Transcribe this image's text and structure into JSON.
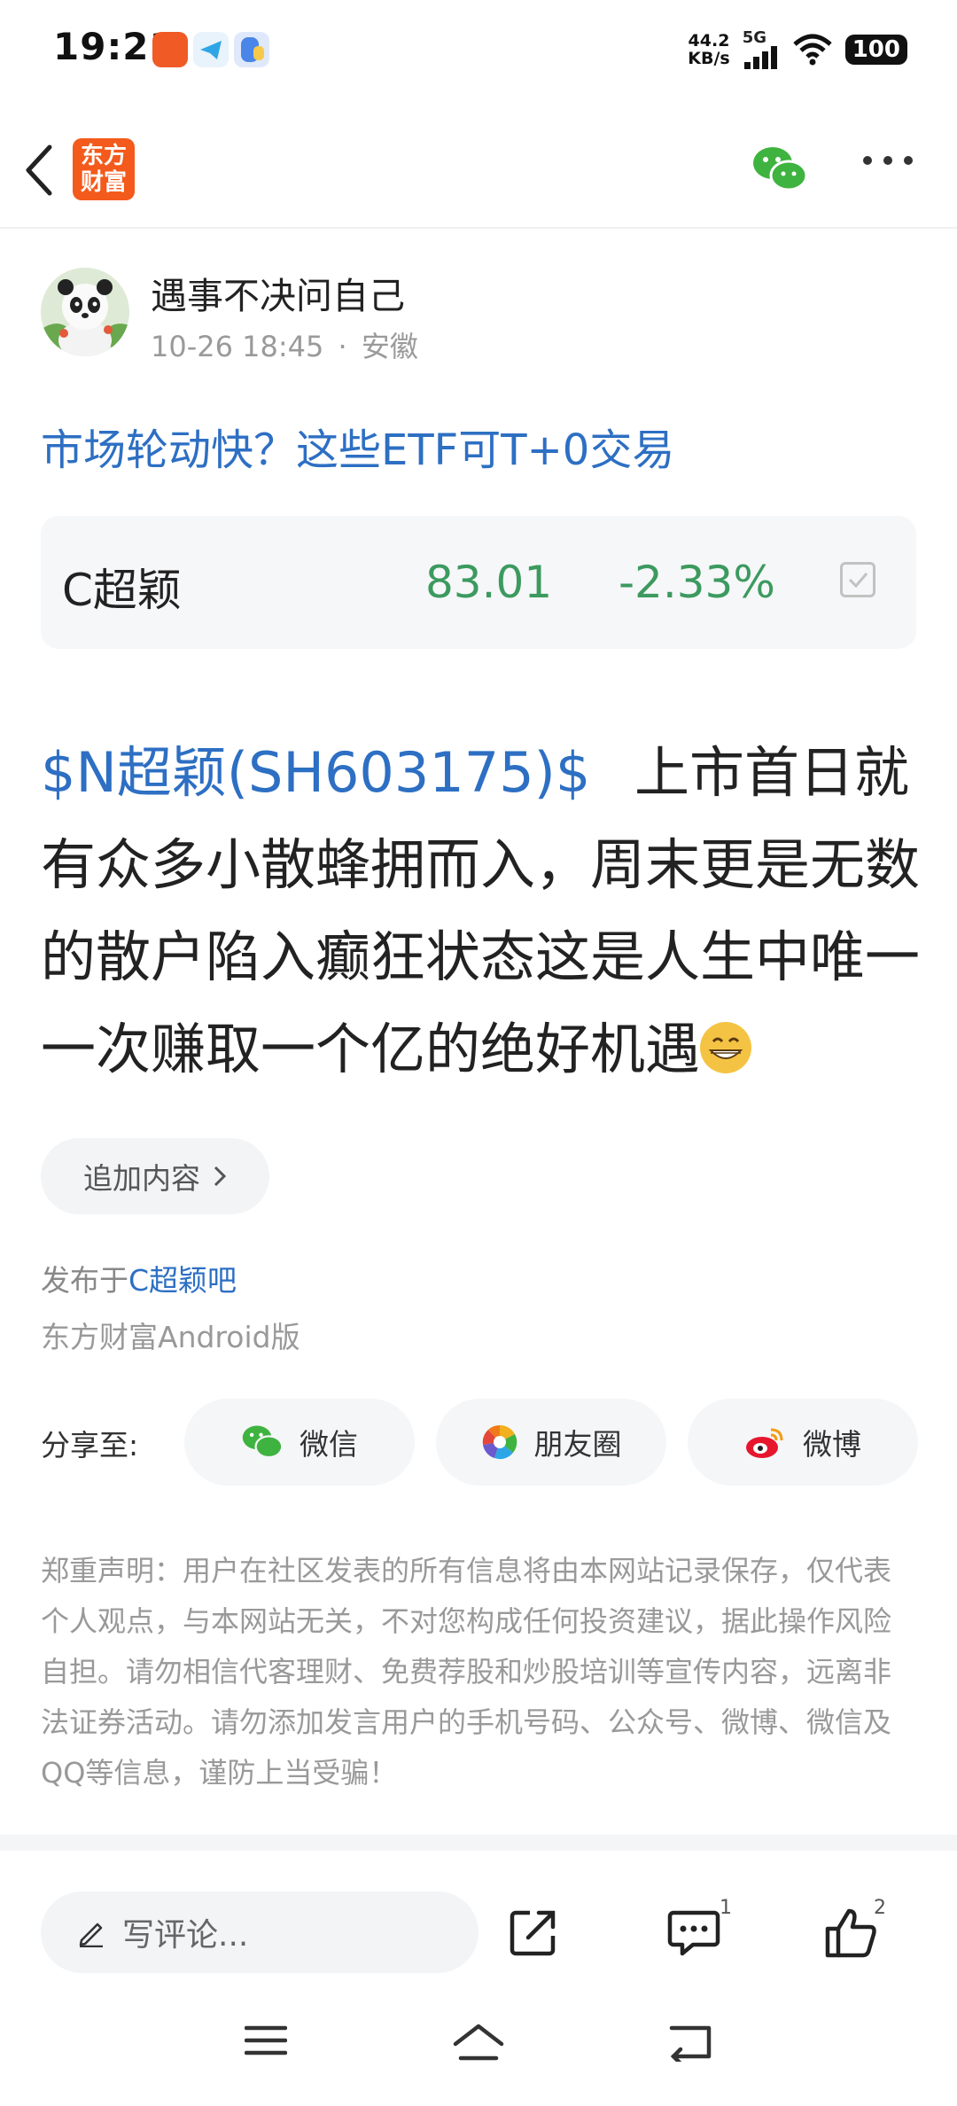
{
  "status_bar": {
    "time": "19:21",
    "net_speed_value": "44.2",
    "net_speed_unit": "KB/s",
    "network": "5G",
    "battery": "100"
  },
  "nav": {
    "logo_line1": "东方",
    "logo_line2": "财富",
    "icons": [
      "back-icon",
      "wechat-icon",
      "more-icon"
    ]
  },
  "author": {
    "name": "遇事不决问自己",
    "time": "10-26 18:45",
    "separator": "·",
    "location": "安徽"
  },
  "post": {
    "title": "市场轮动快？这些ETF可T+0交易",
    "tag": "$N超颖(SH603175)$",
    "body": "上市首日就有众多小散蜂拥而入，周末更是无数的散户陷入癫狂状态这是人生中唯一一次赚取一个亿的绝好机遇"
  },
  "stock_card": {
    "name": "C超颖",
    "price": "83.01",
    "change": "-2.33%",
    "color_down": "#3c9a5f"
  },
  "add_content": {
    "label": "追加内容"
  },
  "publish": {
    "prefix": "发布于",
    "board": "C超颖吧",
    "source": "东方财富Android版"
  },
  "share": {
    "label": "分享至:",
    "wechat": "微信",
    "moments": "朋友圈",
    "weibo": "微博"
  },
  "disclaimer": "郑重声明：用户在社区发表的所有信息将由本网站记录保存，仅代表个人观点，与本网站无关，不对您构成任何投资建议，据此操作风险自担。请勿相信代客理财、免费荐股和炒股培训等宣传内容，远离非法证券活动。请勿添加发言用户的手机号码、公众号、微博、微信及QQ等信息，谨防上当受骗！",
  "bottom_bar": {
    "comment_placeholder": "写评论...",
    "comment_count": "1",
    "like_count": "2"
  },
  "colors": {
    "link_blue": "#2d6fc3",
    "brand_orange": "#f35a1b",
    "wechat_green": "#3fb33f"
  }
}
